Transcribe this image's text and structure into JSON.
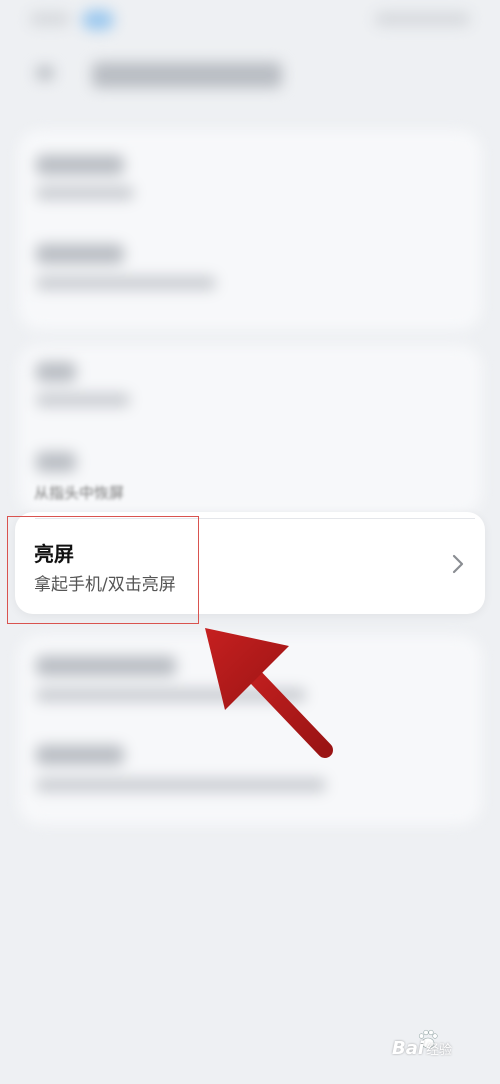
{
  "setting_item": {
    "title": "亮屏",
    "subtitle": "拿起手机/双击亮屏"
  },
  "partial_text": "从指头中恢屏",
  "watermark": {
    "brand": "Bai",
    "suffix": "经验"
  },
  "colors": {
    "highlight": "#d9534f",
    "arrow": "#b31b1b"
  },
  "icons": {
    "chevron": "chevron-right-icon",
    "watermark": "paw-icon"
  }
}
